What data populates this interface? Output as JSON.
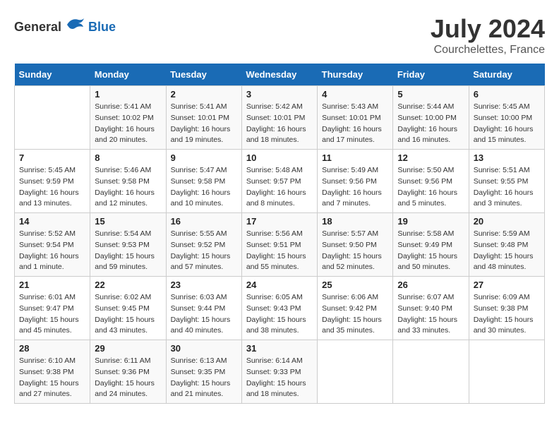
{
  "header": {
    "logo_general": "General",
    "logo_blue": "Blue",
    "month_year": "July 2024",
    "location": "Courchelettes, France"
  },
  "weekdays": [
    "Sunday",
    "Monday",
    "Tuesday",
    "Wednesday",
    "Thursday",
    "Friday",
    "Saturday"
  ],
  "weeks": [
    [
      {
        "day": "",
        "sunrise": "",
        "sunset": "",
        "daylight": ""
      },
      {
        "day": "1",
        "sunrise": "Sunrise: 5:41 AM",
        "sunset": "Sunset: 10:02 PM",
        "daylight": "Daylight: 16 hours and 20 minutes."
      },
      {
        "day": "2",
        "sunrise": "Sunrise: 5:41 AM",
        "sunset": "Sunset: 10:01 PM",
        "daylight": "Daylight: 16 hours and 19 minutes."
      },
      {
        "day": "3",
        "sunrise": "Sunrise: 5:42 AM",
        "sunset": "Sunset: 10:01 PM",
        "daylight": "Daylight: 16 hours and 18 minutes."
      },
      {
        "day": "4",
        "sunrise": "Sunrise: 5:43 AM",
        "sunset": "Sunset: 10:01 PM",
        "daylight": "Daylight: 16 hours and 17 minutes."
      },
      {
        "day": "5",
        "sunrise": "Sunrise: 5:44 AM",
        "sunset": "Sunset: 10:00 PM",
        "daylight": "Daylight: 16 hours and 16 minutes."
      },
      {
        "day": "6",
        "sunrise": "Sunrise: 5:45 AM",
        "sunset": "Sunset: 10:00 PM",
        "daylight": "Daylight: 16 hours and 15 minutes."
      }
    ],
    [
      {
        "day": "7",
        "sunrise": "Sunrise: 5:45 AM",
        "sunset": "Sunset: 9:59 PM",
        "daylight": "Daylight: 16 hours and 13 minutes."
      },
      {
        "day": "8",
        "sunrise": "Sunrise: 5:46 AM",
        "sunset": "Sunset: 9:58 PM",
        "daylight": "Daylight: 16 hours and 12 minutes."
      },
      {
        "day": "9",
        "sunrise": "Sunrise: 5:47 AM",
        "sunset": "Sunset: 9:58 PM",
        "daylight": "Daylight: 16 hours and 10 minutes."
      },
      {
        "day": "10",
        "sunrise": "Sunrise: 5:48 AM",
        "sunset": "Sunset: 9:57 PM",
        "daylight": "Daylight: 16 hours and 8 minutes."
      },
      {
        "day": "11",
        "sunrise": "Sunrise: 5:49 AM",
        "sunset": "Sunset: 9:56 PM",
        "daylight": "Daylight: 16 hours and 7 minutes."
      },
      {
        "day": "12",
        "sunrise": "Sunrise: 5:50 AM",
        "sunset": "Sunset: 9:56 PM",
        "daylight": "Daylight: 16 hours and 5 minutes."
      },
      {
        "day": "13",
        "sunrise": "Sunrise: 5:51 AM",
        "sunset": "Sunset: 9:55 PM",
        "daylight": "Daylight: 16 hours and 3 minutes."
      }
    ],
    [
      {
        "day": "14",
        "sunrise": "Sunrise: 5:52 AM",
        "sunset": "Sunset: 9:54 PM",
        "daylight": "Daylight: 16 hours and 1 minute."
      },
      {
        "day": "15",
        "sunrise": "Sunrise: 5:54 AM",
        "sunset": "Sunset: 9:53 PM",
        "daylight": "Daylight: 15 hours and 59 minutes."
      },
      {
        "day": "16",
        "sunrise": "Sunrise: 5:55 AM",
        "sunset": "Sunset: 9:52 PM",
        "daylight": "Daylight: 15 hours and 57 minutes."
      },
      {
        "day": "17",
        "sunrise": "Sunrise: 5:56 AM",
        "sunset": "Sunset: 9:51 PM",
        "daylight": "Daylight: 15 hours and 55 minutes."
      },
      {
        "day": "18",
        "sunrise": "Sunrise: 5:57 AM",
        "sunset": "Sunset: 9:50 PM",
        "daylight": "Daylight: 15 hours and 52 minutes."
      },
      {
        "day": "19",
        "sunrise": "Sunrise: 5:58 AM",
        "sunset": "Sunset: 9:49 PM",
        "daylight": "Daylight: 15 hours and 50 minutes."
      },
      {
        "day": "20",
        "sunrise": "Sunrise: 5:59 AM",
        "sunset": "Sunset: 9:48 PM",
        "daylight": "Daylight: 15 hours and 48 minutes."
      }
    ],
    [
      {
        "day": "21",
        "sunrise": "Sunrise: 6:01 AM",
        "sunset": "Sunset: 9:47 PM",
        "daylight": "Daylight: 15 hours and 45 minutes."
      },
      {
        "day": "22",
        "sunrise": "Sunrise: 6:02 AM",
        "sunset": "Sunset: 9:45 PM",
        "daylight": "Daylight: 15 hours and 43 minutes."
      },
      {
        "day": "23",
        "sunrise": "Sunrise: 6:03 AM",
        "sunset": "Sunset: 9:44 PM",
        "daylight": "Daylight: 15 hours and 40 minutes."
      },
      {
        "day": "24",
        "sunrise": "Sunrise: 6:05 AM",
        "sunset": "Sunset: 9:43 PM",
        "daylight": "Daylight: 15 hours and 38 minutes."
      },
      {
        "day": "25",
        "sunrise": "Sunrise: 6:06 AM",
        "sunset": "Sunset: 9:42 PM",
        "daylight": "Daylight: 15 hours and 35 minutes."
      },
      {
        "day": "26",
        "sunrise": "Sunrise: 6:07 AM",
        "sunset": "Sunset: 9:40 PM",
        "daylight": "Daylight: 15 hours and 33 minutes."
      },
      {
        "day": "27",
        "sunrise": "Sunrise: 6:09 AM",
        "sunset": "Sunset: 9:38 PM",
        "daylight": "Daylight: 15 hours and 30 minutes."
      }
    ],
    [
      {
        "day": "28",
        "sunrise": "Sunrise: 6:10 AM",
        "sunset": "Sunset: 9:38 PM",
        "daylight": "Daylight: 15 hours and 27 minutes."
      },
      {
        "day": "29",
        "sunrise": "Sunrise: 6:11 AM",
        "sunset": "Sunset: 9:36 PM",
        "daylight": "Daylight: 15 hours and 24 minutes."
      },
      {
        "day": "30",
        "sunrise": "Sunrise: 6:13 AM",
        "sunset": "Sunset: 9:35 PM",
        "daylight": "Daylight: 15 hours and 21 minutes."
      },
      {
        "day": "31",
        "sunrise": "Sunrise: 6:14 AM",
        "sunset": "Sunset: 9:33 PM",
        "daylight": "Daylight: 15 hours and 18 minutes."
      },
      {
        "day": "",
        "sunrise": "",
        "sunset": "",
        "daylight": ""
      },
      {
        "day": "",
        "sunrise": "",
        "sunset": "",
        "daylight": ""
      },
      {
        "day": "",
        "sunrise": "",
        "sunset": "",
        "daylight": ""
      }
    ]
  ]
}
